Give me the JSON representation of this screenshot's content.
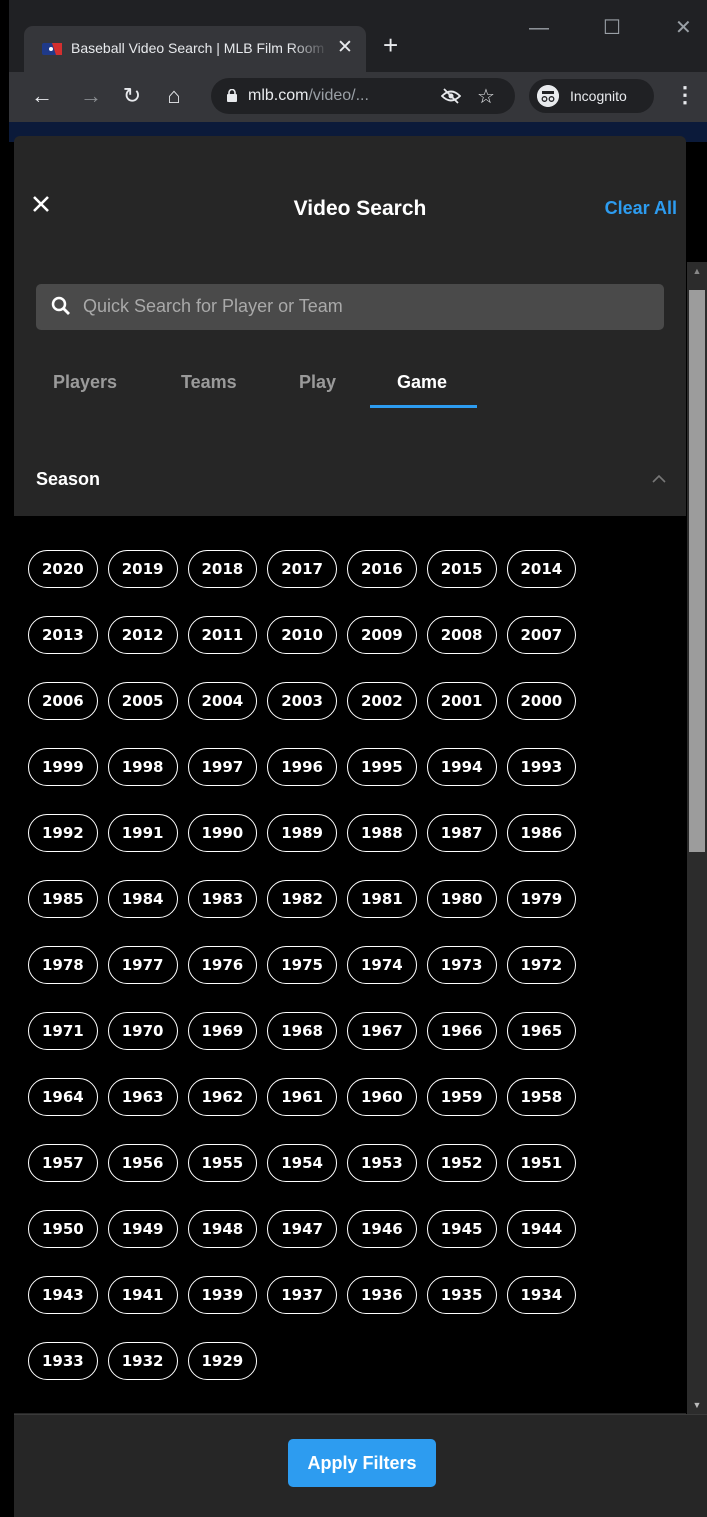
{
  "browser": {
    "tab_title": "Baseball Video Search | MLB Film Room",
    "url_host": "mlb.com",
    "url_path": "/video/...",
    "incognito_label": "Incognito",
    "new_tab": "+",
    "tab_close": "✕",
    "win_min": "—",
    "win_max": "☐",
    "win_close": "✕",
    "back": "←",
    "forward": "→",
    "reload": "↻",
    "home": "⌂",
    "star": "☆",
    "menu": "⋮"
  },
  "header": {
    "title": "Video Search",
    "clear_all": "Clear All"
  },
  "search": {
    "placeholder": "Quick Search for Player or Team"
  },
  "tabs": [
    {
      "label": "Players"
    },
    {
      "label": "Teams"
    },
    {
      "label": "Play"
    },
    {
      "label": "Game",
      "active": true
    }
  ],
  "season": {
    "title": "Season",
    "rows": [
      [
        "2020",
        "2019",
        "2018",
        "2017",
        "2016",
        "2015",
        "2014"
      ],
      [
        "2013",
        "2012",
        "2011",
        "2010",
        "2009",
        "2008",
        "2007"
      ],
      [
        "2006",
        "2005",
        "2004",
        "2003",
        "2002",
        "2001",
        "2000"
      ],
      [
        "1999",
        "1998",
        "1997",
        "1996",
        "1995",
        "1994",
        "1993"
      ],
      [
        "1992",
        "1991",
        "1990",
        "1989",
        "1988",
        "1987",
        "1986"
      ],
      [
        "1985",
        "1984",
        "1983",
        "1982",
        "1981",
        "1980",
        "1979"
      ],
      [
        "1978",
        "1977",
        "1976",
        "1975",
        "1974",
        "1973",
        "1972"
      ],
      [
        "1971",
        "1970",
        "1969",
        "1968",
        "1967",
        "1966",
        "1965"
      ],
      [
        "1964",
        "1963",
        "1962",
        "1961",
        "1960",
        "1959",
        "1958"
      ],
      [
        "1957",
        "1956",
        "1955",
        "1954",
        "1953",
        "1952",
        "1951"
      ],
      [
        "1950",
        "1949",
        "1948",
        "1947",
        "1946",
        "1945",
        "1944"
      ],
      [
        "1943",
        "1941",
        "1939",
        "1937",
        "1936",
        "1935",
        "1934"
      ],
      [
        "1933",
        "1932",
        "1929"
      ]
    ]
  },
  "footer": {
    "apply_label": "Apply Filters"
  },
  "colors": {
    "accent": "#2d9cf0",
    "panel": "#262626",
    "chip_border": "#ffffff"
  }
}
